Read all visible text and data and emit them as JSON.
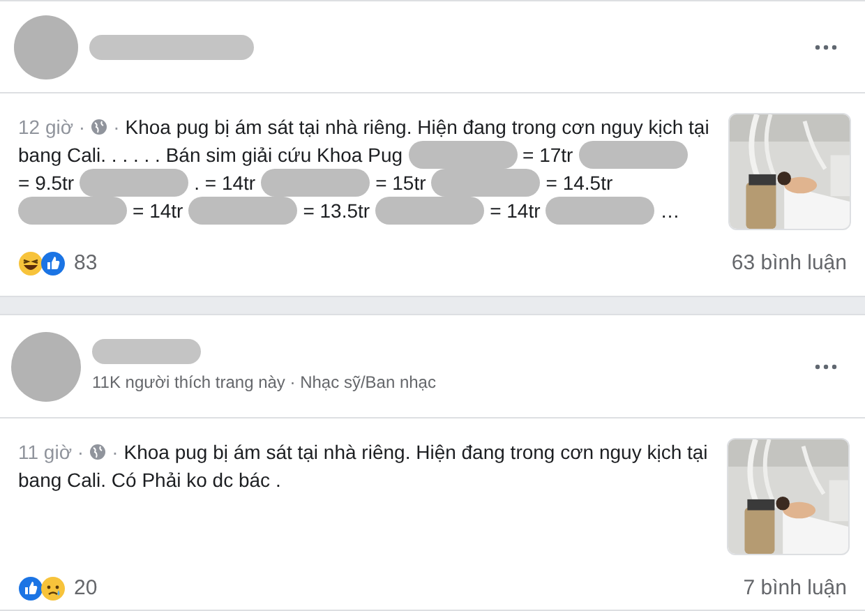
{
  "posts": [
    {
      "time": "12 giờ ·",
      "separator": "·",
      "lines": [
        [
          {
            "kind": "text",
            "text": "Khoa pug bị ám sát tại nhà riêng. Hiện đang trong cơn nguy kịch tại"
          }
        ],
        [
          {
            "kind": "text",
            "text": "bang Cali. . . . . . Bán sim giải cứu Khoa Pug"
          },
          {
            "kind": "redacted"
          },
          {
            "kind": "text",
            "text": "= 17tr"
          },
          {
            "kind": "redacted"
          }
        ],
        [
          {
            "kind": "text",
            "text": "= 9.5tr"
          },
          {
            "kind": "redacted"
          },
          {
            "kind": "text",
            "text": ". = 14tr"
          },
          {
            "kind": "redacted"
          },
          {
            "kind": "text",
            "text": "= 15tr"
          },
          {
            "kind": "redacted"
          },
          {
            "kind": "text",
            "text": "= 14.5tr"
          }
        ],
        [
          {
            "kind": "redacted"
          },
          {
            "kind": "text",
            "text": "= 14tr"
          },
          {
            "kind": "redacted"
          },
          {
            "kind": "text",
            "text": "= 13.5tr"
          },
          {
            "kind": "redacted"
          },
          {
            "kind": "text",
            "text": "= 14tr"
          },
          {
            "kind": "redacted"
          },
          {
            "kind": "text",
            "text": "…"
          }
        ]
      ],
      "reactions": [
        {
          "kind": "haha"
        },
        {
          "kind": "like"
        }
      ],
      "reaction_count": "83",
      "comments": "63 bình luận"
    },
    {
      "header": {
        "subtitle": "11K người thích trang này · Nhạc sỹ/Ban nhạc"
      },
      "time": "11 giờ ·",
      "separator": "·",
      "lines": [
        [
          {
            "kind": "text",
            "text": "Khoa pug bị ám sát tại nhà riêng. Hiện đang trong cơn nguy kịch tại"
          }
        ],
        [
          {
            "kind": "text",
            "text": "bang Cali. Có Phải ko dc bác ."
          }
        ]
      ],
      "reactions": [
        {
          "kind": "like"
        },
        {
          "kind": "sad"
        }
      ],
      "reaction_count": "20",
      "comments": "7 bình luận"
    }
  ]
}
